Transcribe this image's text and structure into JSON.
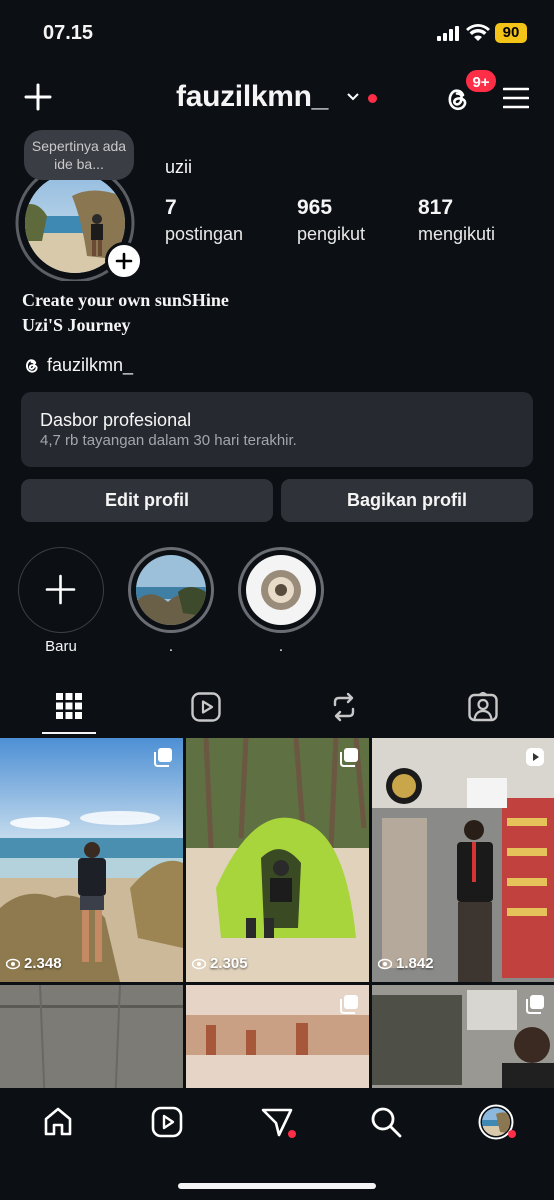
{
  "status_bar": {
    "time": "07.15",
    "battery": "90"
  },
  "header": {
    "username": "fauzilkmn_",
    "notification_count": "9+"
  },
  "profile": {
    "note": "Sepertinya ada ide ba...",
    "display_name": "uzii",
    "stats": [
      {
        "value": "7",
        "label": "postingan"
      },
      {
        "value": "965",
        "label": "pengikut"
      },
      {
        "value": "817",
        "label": "mengikuti"
      }
    ],
    "bio_line1": "Create your own sunSHine",
    "bio_line2": "Uzi'S Journey",
    "threads_handle": "fauzilkmn_"
  },
  "dashboard": {
    "title": "Dasbor profesional",
    "subtitle": "4,7 rb tayangan dalam 30 hari terakhir."
  },
  "buttons": {
    "edit": "Edit profil",
    "share": "Bagikan profil"
  },
  "highlights": [
    {
      "label": "Baru"
    },
    {
      "label": "."
    },
    {
      "label": "."
    }
  ],
  "posts": [
    {
      "views": "2.348",
      "type": "carousel"
    },
    {
      "views": "2.305",
      "type": "carousel"
    },
    {
      "views": "1.842",
      "type": "reel"
    },
    {
      "views": "",
      "type": "none"
    },
    {
      "views": "",
      "type": "carousel"
    },
    {
      "views": "",
      "type": "carousel"
    }
  ],
  "colors": {
    "background": "#0c0f14",
    "accent_red": "#ff2e47",
    "card": "#26292f",
    "button": "#2f3238"
  }
}
